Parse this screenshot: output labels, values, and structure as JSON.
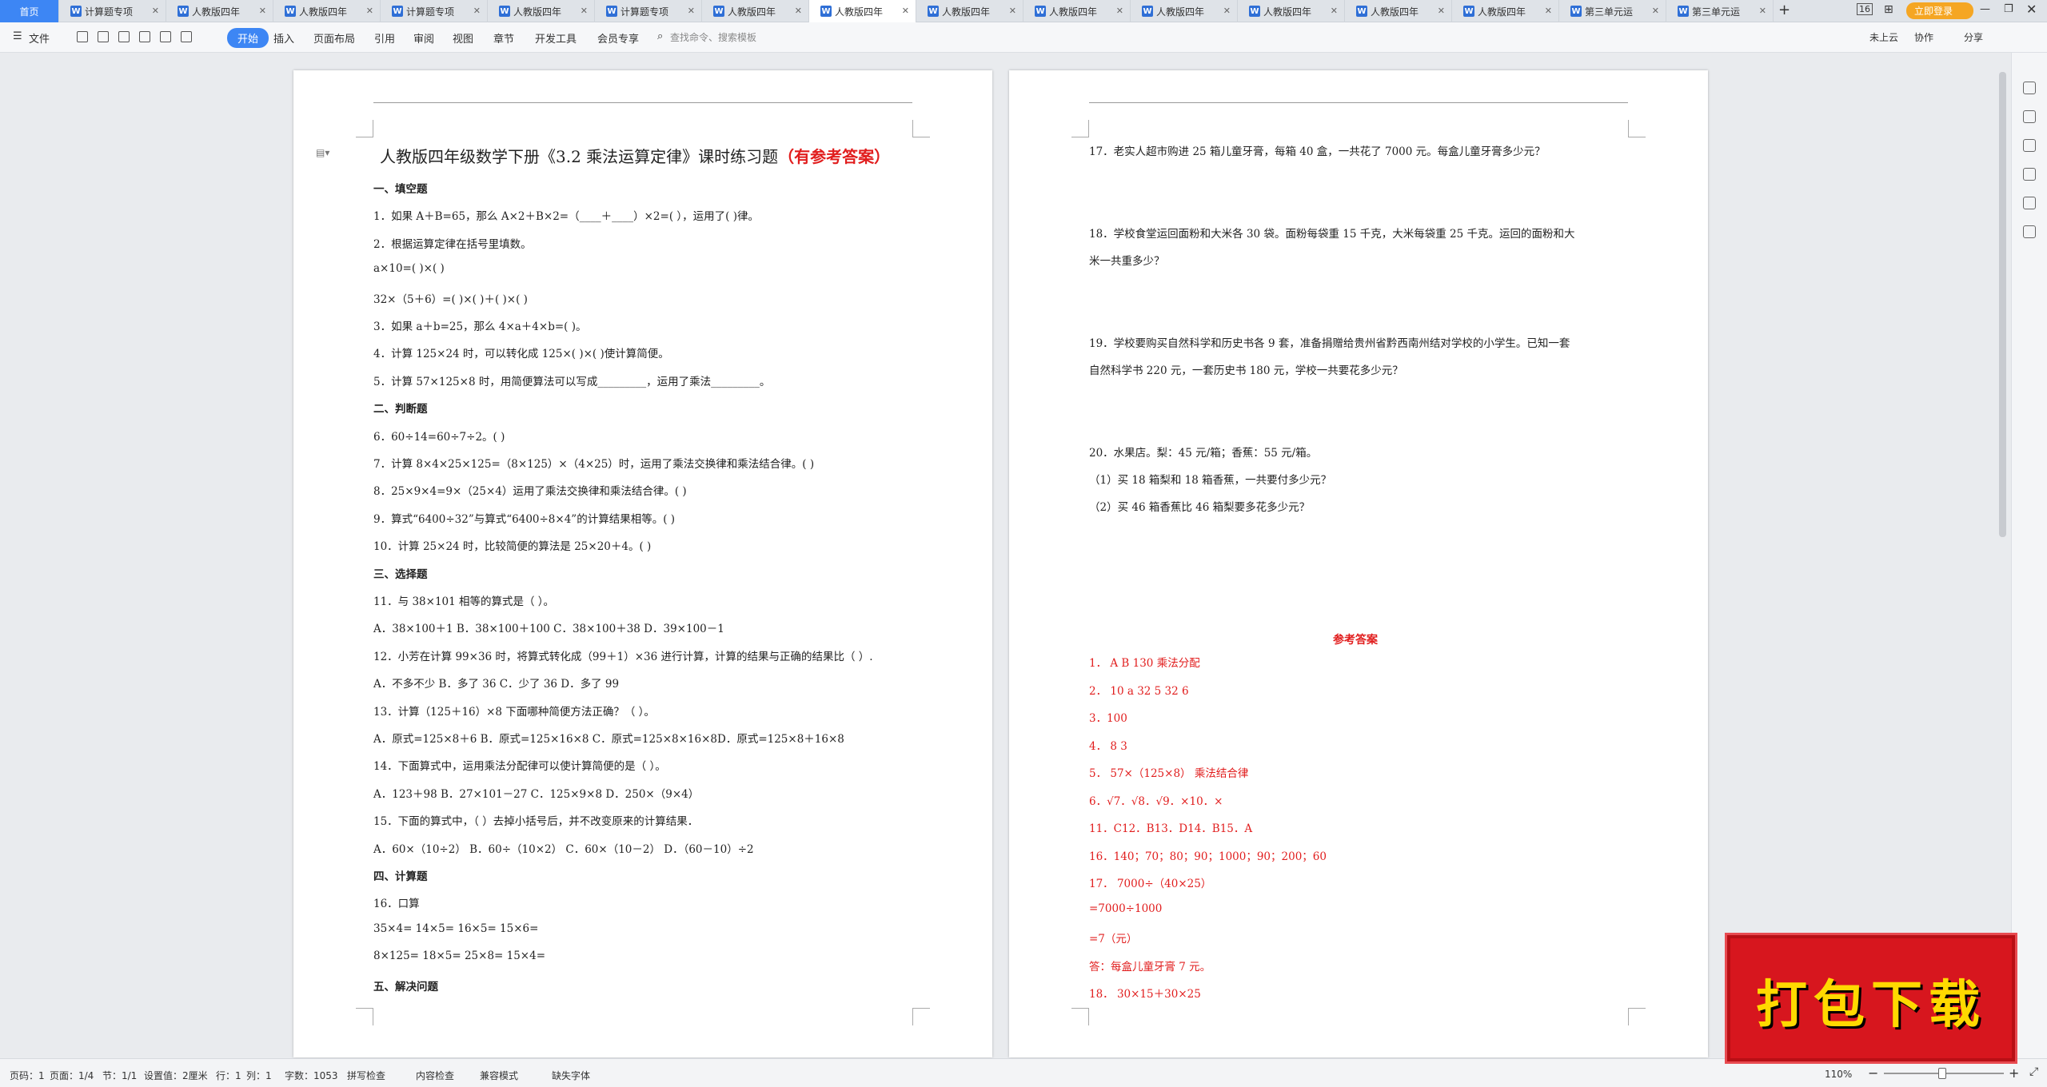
{
  "tabs": [
    {
      "label": "首页"
    },
    {
      "label": "计算题专项"
    },
    {
      "label": "人教版四年"
    },
    {
      "label": "人教版四年"
    },
    {
      "label": "计算题专项"
    },
    {
      "label": "人教版四年"
    },
    {
      "label": "计算题专项"
    },
    {
      "label": "人教版四年"
    },
    {
      "label": "人教版四年"
    },
    {
      "label": "人教版四年"
    },
    {
      "label": "人教版四年"
    },
    {
      "label": "人教版四年"
    },
    {
      "label": "人教版四年"
    },
    {
      "label": "人教版四年"
    },
    {
      "label": "人教版四年"
    },
    {
      "label": "第三单元运"
    },
    {
      "label": "第三单元运"
    }
  ],
  "title_bar": {
    "badge": "16",
    "login": "立即登录"
  },
  "toolbar": {
    "file": "文件",
    "items": [
      "开始",
      "插入",
      "页面布局",
      "引用",
      "审阅",
      "视图",
      "章节",
      "开发工具",
      "会员专享"
    ],
    "search_placeholder": "查找命令、搜索模板",
    "cloud": "未上云",
    "collab": "协作",
    "share": "分享"
  },
  "left_page": {
    "title": "人教版四年级数学下册《3.2 乘法运算定律》课时练习题",
    "title_red": "（有参考答案）",
    "lines": [
      {
        "t": "一、填空题",
        "h": true
      },
      {
        "t": "1．如果 A＋B=65，那么 A×2＋B×2=（____＋____）×2=(            ），运用了(            )律。"
      },
      {
        "t": "2．根据运算定律在括号里填数。"
      },
      {
        "t": "a×10=(          )×(          )"
      },
      {
        "t": "32×（5＋6）=(          )×(          )＋(          )×(          )"
      },
      {
        "t": "3．如果 a＋b=25，那么 4×a＋4×b=(            )。"
      },
      {
        "t": "4．计算 125×24 时，可以转化成 125×(       )×(       )使计算简便。"
      },
      {
        "t": "5．计算 57×125×8 时，用简便算法可以写成_________，运用了乘法_________。"
      },
      {
        "t": "二、判断题",
        "h": true
      },
      {
        "t": "6．60÷14=60÷7÷2。(            )"
      },
      {
        "t": "7．计算 8×4×25×125=（8×125）×（4×25）时，运用了乘法交换律和乘法结合律。(            )"
      },
      {
        "t": "8．25×9×4=9×（25×4）运用了乘法交换律和乘法结合律。(            )"
      },
      {
        "t": "9．算式“6400÷32”与算式“6400÷8×4”的计算结果相等。(            )"
      },
      {
        "t": "10．计算 25×24 时，比较简便的算法是 25×20＋4。(            )"
      },
      {
        "t": "三、选择题",
        "h": true
      },
      {
        "t": "11．与 38×101 相等的算式是（    ）。"
      },
      {
        "t": "A．38×100＋1             B．38×100＋100          C．38×100＋38            D．39×100－1"
      },
      {
        "t": "12．小芳在计算 99×36 时，将算式转化成（99＋1）×36 进行计算，计算的结果与正确的结果比（       ）."
      },
      {
        "t": "A．不多不少                B．多了 36                   C．少了 36                   D．多了 99"
      },
      {
        "t": "13．计算（125＋16）×8 下面哪种简便方法正确？（    ）。"
      },
      {
        "t": "A．原式=125×8＋6     B．原式=125×16×8    C．原式=125×8×16×8D．原式=125×8＋16×8"
      },
      {
        "t": "14．下面算式中，运用乘法分配律可以使计算简便的是（    ）。"
      },
      {
        "t": "A．123＋98                 B．27×101－27            C．125×9×8                 D．250×（9×4）"
      },
      {
        "t": "15．下面的算式中，（        ）去掉小括号后，并不改变原来的计算结果．"
      },
      {
        "t": "A．60×（10÷2）          B．60÷（10×2）         C．60×（10－2）         D．（60－10）÷2"
      },
      {
        "t": "四、计算题",
        "h": true
      },
      {
        "t": "16．口算"
      },
      {
        "t": "35×4=        14×5=        16×5=        15×6="
      },
      {
        "t": "8×125=        18×5=        25×8=        15×4="
      },
      {
        "t": "五、解决问题",
        "h": true
      }
    ]
  },
  "right_page": {
    "problems": [
      {
        "t": "17．老实人超市购进 25 箱儿童牙膏，每箱 40 盒，一共花了 7000 元。每盒儿童牙膏多少元？"
      },
      {
        "t": "18．学校食堂运回面粉和大米各 30 袋。面粉每袋重 15 千克，大米每袋重 25 千克。运回的面粉和大"
      },
      {
        "t": "米一共重多少？"
      },
      {
        "t": "19．学校要购买自然科学和历史书各 9 套，准备捐赠给贵州省黔西南州结对学校的小学生。已知一套"
      },
      {
        "t": "自然科学书 220 元，一套历史书 180 元，学校一共要花多少元？"
      },
      {
        "t": "20．水果店。梨：45 元/箱；香蕉：55 元/箱。"
      },
      {
        "t": "（1）买 18 箱梨和 18 箱香蕉，一共要付多少元？"
      },
      {
        "t": "（2）买 46 箱香蕉比 46 箱梨要多花多少元？"
      }
    ],
    "answer_title": "参考答案",
    "answers": [
      "1．    A     B     130      乘法分配",
      "2．    10     a     32     5     32     6",
      "3．100",
      "4．    8      3",
      "5．    57×（125×8）      乘法结合律",
      "6．√7．√8．√9．×10．×",
      "11．C12．B13．D14．B15．A",
      "16．140；70；80；90；1000；90；200；60",
      "17．  7000÷（40×25）",
      "=7000÷1000",
      "=7（元）",
      "答：每盒儿童牙膏 7 元。",
      "18．  30×15＋30×25"
    ]
  },
  "status": {
    "page_no": "页码：1",
    "pages": "页面：1/4",
    "section": "节：1/1",
    "setting": "设置值：2厘米",
    "row": "行：1",
    "col": "列：1",
    "words": "字数：1053",
    "spell": "拼写检查",
    "content": "内容检查",
    "compat": "兼容模式",
    "font": "缺失字体",
    "zoom": "110%"
  },
  "banner": {
    "text": "打包下载"
  }
}
